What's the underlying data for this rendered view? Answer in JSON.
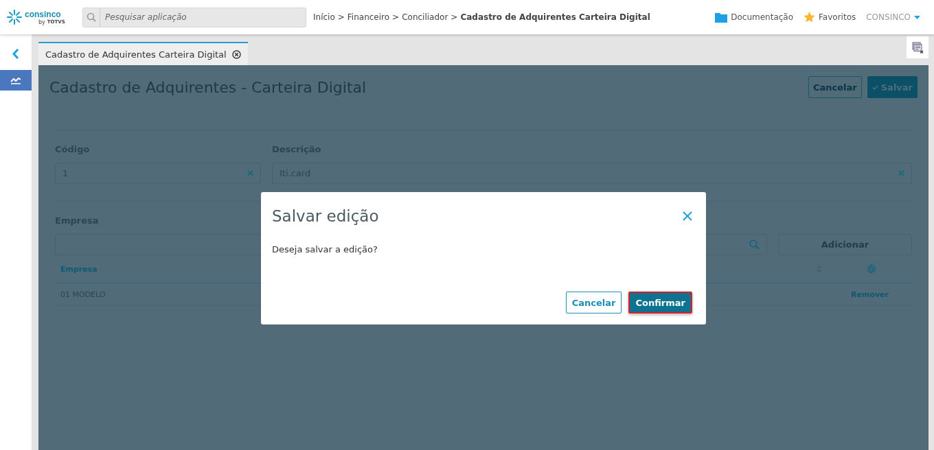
{
  "header": {
    "logo": {
      "name": "consinco",
      "sub": "by",
      "brand": "TOTVS"
    },
    "search": {
      "placeholder": "Pesquisar aplicação"
    },
    "breadcrumb": [
      "Início",
      ">",
      "Financeiro",
      ">",
      "Conciliador",
      ">",
      "Cadastro de Adquirentes Carteira Digital"
    ],
    "links": [
      "Documentação",
      "Favoritos"
    ],
    "user": "CONSINCO"
  },
  "tabs": [
    {
      "label": "Cadastro de Adquirentes Carteira Digital",
      "selected": true
    }
  ],
  "page": {
    "title": "Cadastro de Adquirentes - Carteira Digital",
    "buttons": [
      "Cancelar",
      "Salvar"
    ],
    "fields": [
      {
        "label": "Código",
        "value": "1"
      },
      {
        "label": "Descrição",
        "value": "Iti.card"
      }
    ],
    "empresa": {
      "label": "Empresa",
      "add_button": "Adicionar"
    },
    "table": {
      "columns": [
        "Empresa"
      ],
      "rows": [
        {
          "empresa": "01 MODELO",
          "action": "Remover"
        }
      ]
    }
  },
  "modal": {
    "title": "Salvar edição",
    "message": "Deseja salvar a edição?",
    "buttons": [
      {
        "label": "Cancelar",
        "kind": "secondary"
      },
      {
        "label": "Confirmar",
        "kind": "primary"
      }
    ]
  }
}
